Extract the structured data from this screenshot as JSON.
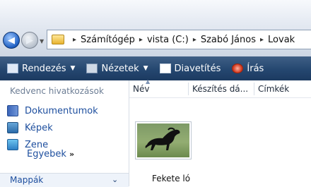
{
  "nav": {
    "back_glyph": "◀",
    "forward_glyph": "▶",
    "history_glyph": "▼"
  },
  "address": {
    "crumbs": [
      "Számítógép",
      "vista (C:)",
      "Szabó János",
      "Lovak"
    ],
    "separator": "▸"
  },
  "toolbar": {
    "organize": "Rendezés",
    "views": "Nézetek",
    "slideshow": "Diavetítés",
    "burn": "Írás",
    "chevron": "▼"
  },
  "left": {
    "favorites_title": "Kedvenc hivatkozások",
    "items": [
      {
        "label": "Dokumentumok",
        "icon": "documents-icon"
      },
      {
        "label": "Képek",
        "icon": "pictures-icon"
      },
      {
        "label": "Zene",
        "icon": "music-icon"
      }
    ],
    "more_label": "Egyebek",
    "more_glyph": "»",
    "folders_label": "Mappák",
    "folders_glyph": "⌄"
  },
  "columns": {
    "name": "Név",
    "date": "Készítés dá...",
    "tags": "Címkék",
    "sort_glyph": "▲"
  },
  "files": [
    {
      "name": "Fekete ló"
    }
  ],
  "colors": {
    "toolbar": "#254770",
    "link": "#1d4e9e"
  }
}
